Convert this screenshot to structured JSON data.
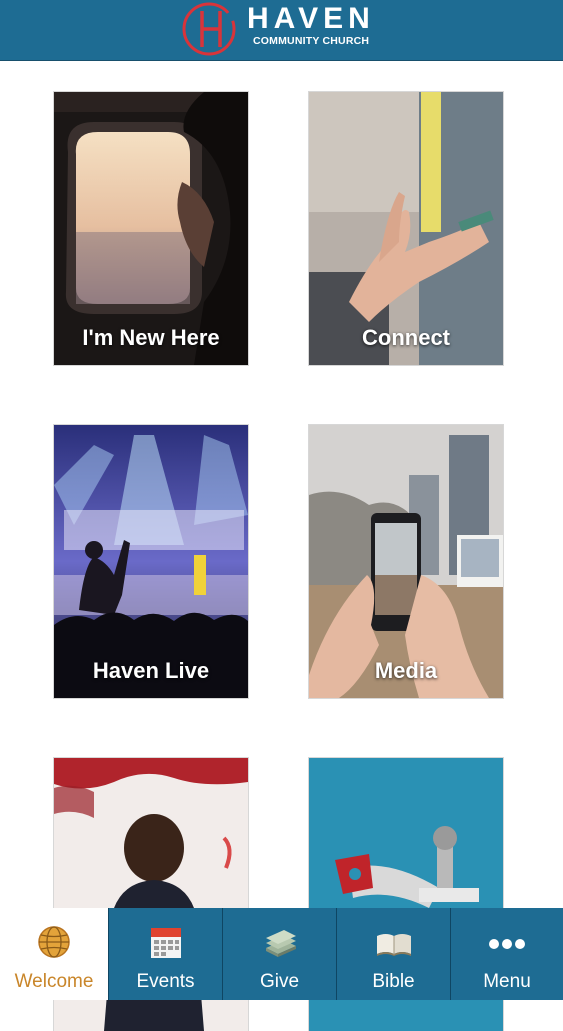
{
  "header": {
    "brand": "HAVEN",
    "brand_sub": "COMMUNITY CHURCH",
    "logo_color": "#d9343a",
    "bar_color": "#1e6c93"
  },
  "tiles": [
    {
      "label": "I'm New Here",
      "image": "woman-at-airplane-window"
    },
    {
      "label": "Connect",
      "image": "hands-high-five"
    },
    {
      "label": "Haven Live",
      "image": "worship-concert-stage"
    },
    {
      "label": "Media",
      "image": "phone-taking-photo"
    },
    {
      "label": "",
      "image": "pastor-speaking"
    },
    {
      "label": "",
      "image": "tools-illustration"
    }
  ],
  "tabs": [
    {
      "label": "Welcome",
      "icon": "globe-icon",
      "active": true
    },
    {
      "label": "Events",
      "icon": "calendar-icon",
      "active": false
    },
    {
      "label": "Give",
      "icon": "money-stack-icon",
      "active": false
    },
    {
      "label": "Bible",
      "icon": "open-book-icon",
      "active": false
    },
    {
      "label": "Menu",
      "icon": "more-dots-icon",
      "active": false
    }
  ],
  "colors": {
    "tab_active_text": "#c9862a",
    "tab_text": "#ffffff"
  }
}
